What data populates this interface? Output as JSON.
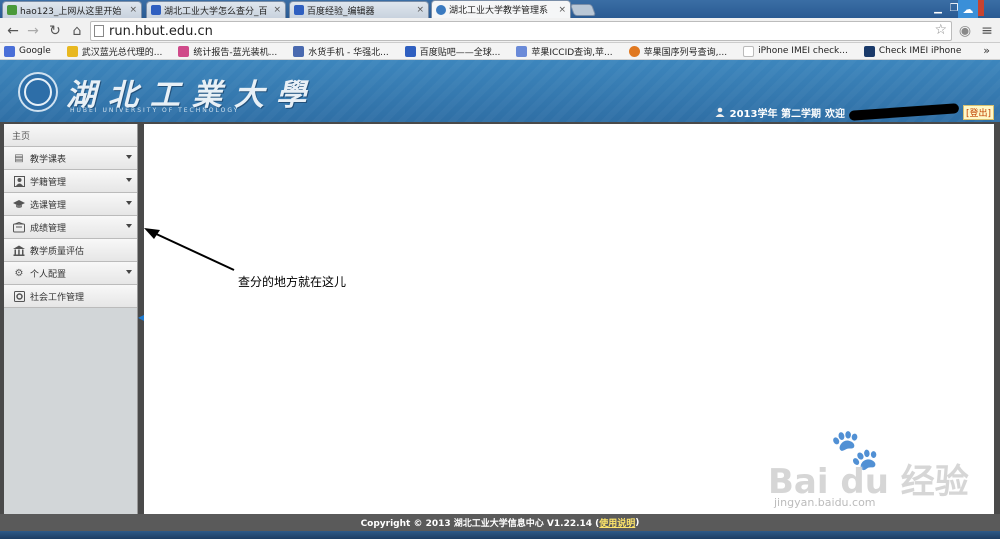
{
  "browser": {
    "tabs": [
      {
        "title": "hao123_上网从这里开始",
        "close": "×",
        "icon_color": "#4a9a3a"
      },
      {
        "title": "湖北工业大学怎么查分_百",
        "close": "×",
        "icon_color": "#2f5fc0"
      },
      {
        "title": "百度经验_编辑器",
        "close": "×",
        "icon_color": "#2f5fc0"
      },
      {
        "title": "湖北工业大学教学管理系",
        "close": "×",
        "icon_color": "#3a7ac0"
      }
    ],
    "url": "run.hbut.edu.cn",
    "bookmarks": [
      {
        "label": "Google",
        "icon_color": "#4a6fd8"
      },
      {
        "label": "武汉蓝光总代理的...",
        "icon_color": "#e8b820"
      },
      {
        "label": "统计报告-蓝光装机...",
        "icon_color": "#d04a8a"
      },
      {
        "label": "水货手机 - 华强北...",
        "icon_color": "#4a6ab0"
      },
      {
        "label": "百度贴吧——全球...",
        "icon_color": "#2f5fc0"
      },
      {
        "label": "苹果ICCID查询,苹...",
        "icon_color": "#6a8ad8"
      },
      {
        "label": "苹果国序列号查询,...",
        "icon_color": "#e07820"
      },
      {
        "label": "iPhone IMEI check...",
        "icon_color": "#dddddd"
      },
      {
        "label": "Check IMEI iPhone",
        "icon_color": "#1a3a6a"
      }
    ],
    "more": "»"
  },
  "site": {
    "logo_text": "湖北工業大學",
    "logo_en": "HUBEI UNIVERSITY OF TECHNOLOGY",
    "term": "2013学年 第二学期",
    "welcome": "欢迎",
    "logout": "[登出]"
  },
  "sidebar": {
    "home": "主页",
    "items": [
      {
        "label": "教学课表",
        "icon": "schedule-icon",
        "glyph": "▤",
        "has_caret": true
      },
      {
        "label": "学籍管理",
        "icon": "student-icon",
        "glyph": "👤",
        "has_caret": true
      },
      {
        "label": "选课管理",
        "icon": "course-select-icon",
        "glyph": "🎓",
        "has_caret": true
      },
      {
        "label": "成绩管理",
        "icon": "grades-icon",
        "glyph": "▭",
        "has_caret": true
      },
      {
        "label": "教学质量评估",
        "icon": "evaluation-icon",
        "glyph": "🏛",
        "has_caret": false
      },
      {
        "label": "个人配置",
        "icon": "settings-icon",
        "glyph": "⚙",
        "has_caret": true
      },
      {
        "label": "社会工作管理",
        "icon": "social-work-icon",
        "glyph": "◘",
        "has_caret": false
      }
    ]
  },
  "annotation": "查分的地方就在这儿",
  "footer": {
    "prefix": "Copyright © 2013  湖北工业大学信息中心  V1.22.14  (",
    "link": "使用说明",
    "suffix": ")"
  },
  "watermark": {
    "brand": "Bai du 经验",
    "url": "jingyan.baidu.com"
  }
}
